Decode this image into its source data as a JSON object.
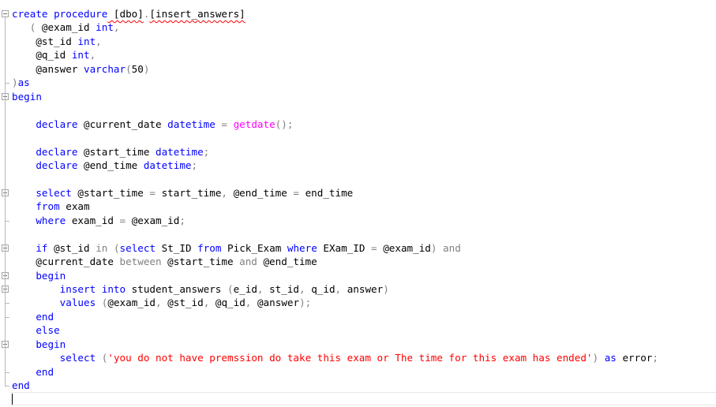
{
  "lines": [
    {
      "fold": "box",
      "tokens": [
        {
          "t": "create procedure",
          "c": "kw"
        },
        {
          "t": " [dbo]",
          "c": "sq"
        },
        {
          "t": ".",
          "c": "op"
        },
        {
          "t": "[insert_answers]",
          "c": "sq"
        }
      ]
    },
    {
      "tokens": [
        {
          "t": "   "
        },
        {
          "t": "( ",
          "c": "op"
        },
        {
          "t": "@exam_id "
        },
        {
          "t": "int",
          "c": "kw"
        },
        {
          "t": ",",
          "c": "op"
        }
      ]
    },
    {
      "tokens": [
        {
          "t": "    @st_id "
        },
        {
          "t": "int",
          "c": "kw"
        },
        {
          "t": ",",
          "c": "op"
        }
      ]
    },
    {
      "tokens": [
        {
          "t": "    @q_id "
        },
        {
          "t": "int",
          "c": "kw"
        },
        {
          "t": ",",
          "c": "op"
        }
      ]
    },
    {
      "tokens": [
        {
          "t": "    @answer "
        },
        {
          "t": "varchar",
          "c": "kw"
        },
        {
          "t": "(",
          "c": "op"
        },
        {
          "t": "50"
        },
        {
          "t": ")",
          "c": "op"
        }
      ]
    },
    {
      "fold": "end",
      "tokens": [
        {
          "t": ")",
          "c": "op"
        },
        {
          "t": "as",
          "c": "kw"
        }
      ]
    },
    {
      "fold": "box",
      "tokens": [
        {
          "t": "begin",
          "c": "kw"
        }
      ]
    },
    {
      "tokens": []
    },
    {
      "tokens": [
        {
          "t": "    "
        },
        {
          "t": "declare",
          "c": "kw"
        },
        {
          "t": " @current_date "
        },
        {
          "t": "datetime",
          "c": "kw"
        },
        {
          "t": " = ",
          "c": "op"
        },
        {
          "t": "getdate",
          "c": "fn"
        },
        {
          "t": "();",
          "c": "op"
        }
      ]
    },
    {
      "tokens": []
    },
    {
      "tokens": [
        {
          "t": "    "
        },
        {
          "t": "declare",
          "c": "kw"
        },
        {
          "t": " @start_time "
        },
        {
          "t": "datetime",
          "c": "kw"
        },
        {
          "t": ";",
          "c": "op"
        }
      ]
    },
    {
      "tokens": [
        {
          "t": "    "
        },
        {
          "t": "declare",
          "c": "kw"
        },
        {
          "t": " @end_time "
        },
        {
          "t": "datetime",
          "c": "kw"
        },
        {
          "t": ";",
          "c": "op"
        }
      ]
    },
    {
      "tokens": []
    },
    {
      "fold": "box",
      "tokens": [
        {
          "t": "    "
        },
        {
          "t": "select",
          "c": "kw"
        },
        {
          "t": " @start_time "
        },
        {
          "t": "=",
          "c": "op"
        },
        {
          "t": " start_time"
        },
        {
          "t": ",",
          "c": "op"
        },
        {
          "t": " @end_time "
        },
        {
          "t": "=",
          "c": "op"
        },
        {
          "t": " end_time"
        }
      ]
    },
    {
      "tokens": [
        {
          "t": "    "
        },
        {
          "t": "from",
          "c": "kw"
        },
        {
          "t": " exam"
        }
      ]
    },
    {
      "fold": "end",
      "tokens": [
        {
          "t": "    "
        },
        {
          "t": "where",
          "c": "kw"
        },
        {
          "t": " exam_id "
        },
        {
          "t": "=",
          "c": "op"
        },
        {
          "t": " @exam_id"
        },
        {
          "t": ";",
          "c": "op"
        }
      ]
    },
    {
      "tokens": []
    },
    {
      "fold": "box",
      "tokens": [
        {
          "t": "    "
        },
        {
          "t": "if",
          "c": "kw"
        },
        {
          "t": " @st_id "
        },
        {
          "t": "in",
          "c": "op"
        },
        {
          "t": " ",
          "c": "op"
        },
        {
          "t": "(",
          "c": "op"
        },
        {
          "t": "select",
          "c": "kw"
        },
        {
          "t": " St_ID "
        },
        {
          "t": "from",
          "c": "kw"
        },
        {
          "t": " Pick_Exam "
        },
        {
          "t": "where",
          "c": "kw"
        },
        {
          "t": " EXam_ID "
        },
        {
          "t": "=",
          "c": "op"
        },
        {
          "t": " @exam_id"
        },
        {
          "t": ") and",
          "c": "op"
        }
      ]
    },
    {
      "tokens": [
        {
          "t": "    @current_date "
        },
        {
          "t": "between",
          "c": "op"
        },
        {
          "t": " @start_time "
        },
        {
          "t": "and",
          "c": "op"
        },
        {
          "t": " @end_time"
        }
      ]
    },
    {
      "fold": "box",
      "tokens": [
        {
          "t": "    "
        },
        {
          "t": "begin",
          "c": "kw"
        }
      ]
    },
    {
      "fold": "box",
      "tokens": [
        {
          "t": "        "
        },
        {
          "t": "insert into",
          "c": "kw"
        },
        {
          "t": " student_answers "
        },
        {
          "t": "(",
          "c": "op"
        },
        {
          "t": "e_id"
        },
        {
          "t": ",",
          "c": "op"
        },
        {
          "t": " st_id"
        },
        {
          "t": ",",
          "c": "op"
        },
        {
          "t": " q_id"
        },
        {
          "t": ",",
          "c": "op"
        },
        {
          "t": " answer"
        },
        {
          "t": ")",
          "c": "op"
        }
      ]
    },
    {
      "fold": "end",
      "tokens": [
        {
          "t": "        "
        },
        {
          "t": "values",
          "c": "kw"
        },
        {
          "t": " ",
          "c": "op"
        },
        {
          "t": "(",
          "c": "op"
        },
        {
          "t": "@exam_id"
        },
        {
          "t": ",",
          "c": "op"
        },
        {
          "t": " @st_id"
        },
        {
          "t": ",",
          "c": "op"
        },
        {
          "t": " @q_id"
        },
        {
          "t": ",",
          "c": "op"
        },
        {
          "t": " @answer"
        },
        {
          "t": ");",
          "c": "op"
        }
      ]
    },
    {
      "fold": "end",
      "tokens": [
        {
          "t": "    "
        },
        {
          "t": "end",
          "c": "kw"
        }
      ]
    },
    {
      "tokens": [
        {
          "t": "    "
        },
        {
          "t": "else",
          "c": "kw"
        }
      ]
    },
    {
      "fold": "box",
      "tokens": [
        {
          "t": "    "
        },
        {
          "t": "begin",
          "c": "kw"
        }
      ]
    },
    {
      "tokens": [
        {
          "t": "        "
        },
        {
          "t": "select",
          "c": "kw"
        },
        {
          "t": " ",
          "c": "op"
        },
        {
          "t": "(",
          "c": "op"
        },
        {
          "t": "'you do not have premssion do take this exam or The time for this exam has ended'",
          "c": "str"
        },
        {
          "t": ")",
          "c": "op"
        },
        {
          "t": " "
        },
        {
          "t": "as",
          "c": "kw"
        },
        {
          "t": " error"
        },
        {
          "t": ";",
          "c": "op"
        }
      ]
    },
    {
      "fold": "end",
      "tokens": [
        {
          "t": "    "
        },
        {
          "t": "end",
          "c": "kw"
        }
      ]
    },
    {
      "fold": "end",
      "tokens": [
        {
          "t": "end",
          "c": "kw"
        }
      ]
    },
    {
      "tokens": []
    }
  ]
}
